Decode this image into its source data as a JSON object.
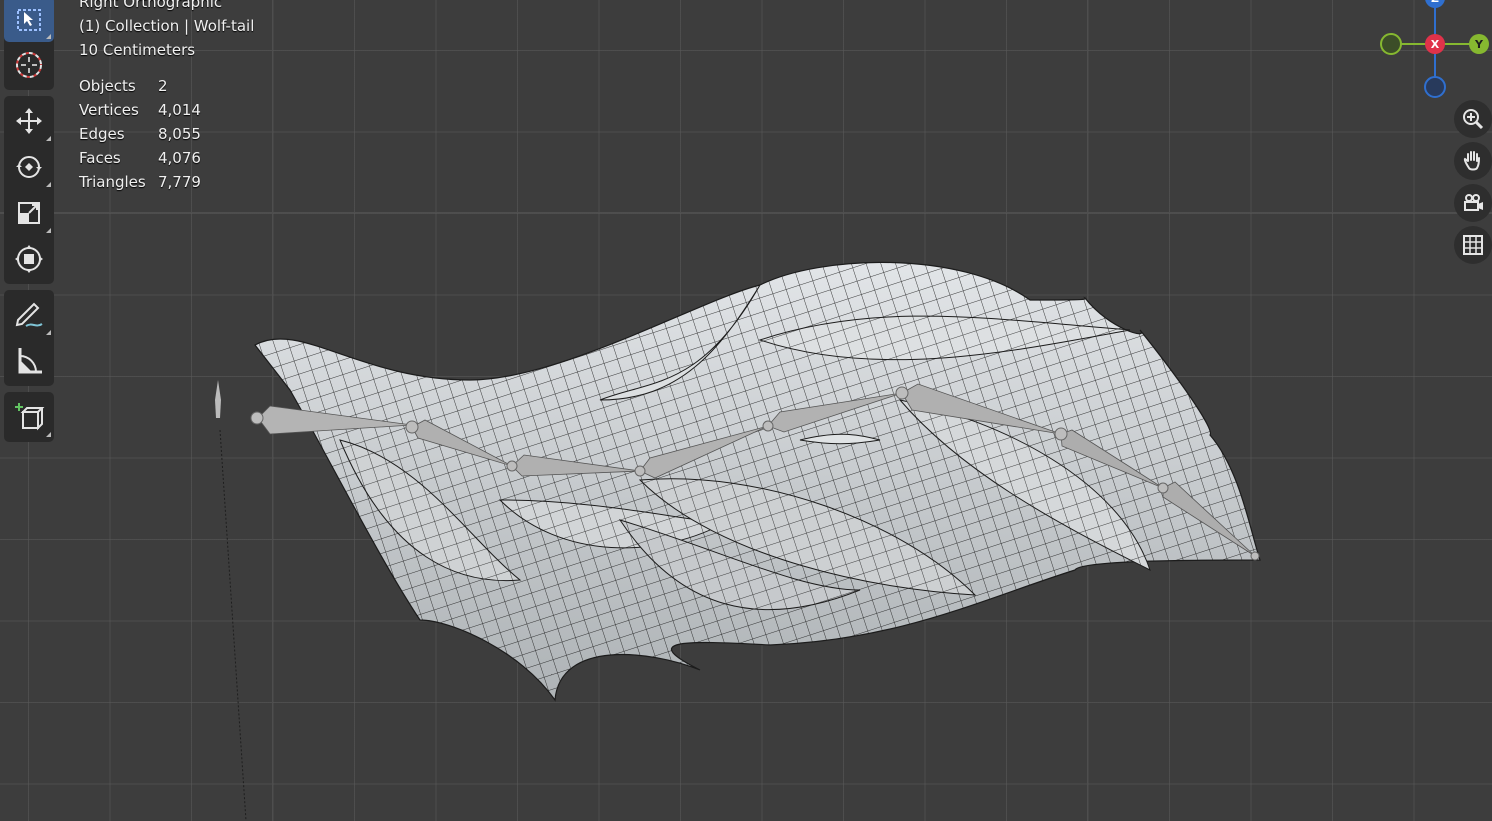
{
  "viewport": {
    "view_name": "Right Orthographic",
    "collection_line": "(1) Collection | Wolf-tail",
    "scale_line": "10 Centimeters"
  },
  "stats": [
    {
      "label": "Objects",
      "value": "2"
    },
    {
      "label": "Vertices",
      "value": "4,014"
    },
    {
      "label": "Edges",
      "value": "8,055"
    },
    {
      "label": "Faces",
      "value": "4,076"
    },
    {
      "label": "Triangles",
      "value": "7,779"
    }
  ],
  "toolbar": {
    "tools": [
      "select-box-icon",
      "cursor-icon",
      "move-icon",
      "rotate-icon",
      "scale-icon",
      "transform-icon",
      "annotate-icon",
      "measure-icon",
      "add-cube-icon"
    ]
  },
  "gizmo": {
    "x_label": "X",
    "y_label": "Y",
    "z_label": "Z",
    "x_color": "#e0324a",
    "y_color": "#86b830",
    "z_color": "#2f6fcf"
  },
  "nav": [
    "zoom-icon",
    "hand-pan-icon",
    "camera-icon",
    "grid-icon"
  ],
  "colors": {
    "background": "#3d3d3d",
    "mesh": "#c9cdd1",
    "wire": "#1a1a1a",
    "accent": "#3a5b8a"
  }
}
